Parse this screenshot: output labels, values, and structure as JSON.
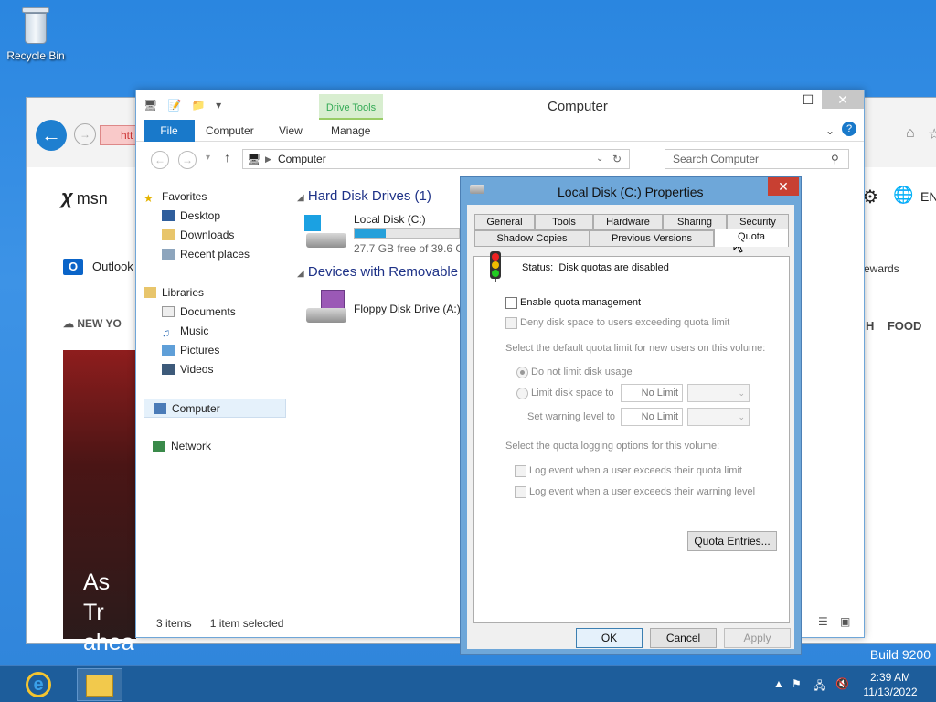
{
  "desktop": {
    "recycle_bin": "Recycle Bin",
    "build": "Build 9200"
  },
  "ie": {
    "address_fragment": "htt",
    "msn": "msn",
    "outlook": "Outlook",
    "news_fragment": "NEW YO",
    "hero_line1": "As Tr",
    "hero_line2": "ahea",
    "lang": "EN",
    "rewards": "ewards",
    "h_fragment": "H",
    "food": "FOOD"
  },
  "explorer": {
    "title": "Computer",
    "drive_tools": "Drive Tools",
    "ribbon": {
      "file": "File",
      "computer": "Computer",
      "view": "View",
      "manage": "Manage"
    },
    "address": "Computer",
    "search_placeholder": "Search Computer",
    "tree": {
      "favorites": "Favorites",
      "desktop": "Desktop",
      "downloads": "Downloads",
      "recent": "Recent places",
      "libraries": "Libraries",
      "documents": "Documents",
      "music": "Music",
      "pictures": "Pictures",
      "videos": "Videos",
      "computer": "Computer",
      "network": "Network"
    },
    "hdd_group": "Hard Disk Drives (1)",
    "local_disk": "Local Disk (C:)",
    "local_disk_free": "27.7 GB free of 39.6 GB",
    "local_disk_used_fraction": 0.3,
    "removable_group": "Devices with Removable",
    "floppy": "Floppy Disk Drive (A:)",
    "status_items": "3 items",
    "status_selected": "1 item selected"
  },
  "dialog": {
    "title": "Local Disk (C:) Properties",
    "tabs_row1": [
      "General",
      "Tools",
      "Hardware",
      "Sharing",
      "Security"
    ],
    "tabs_row2": [
      "Shadow Copies",
      "Previous Versions",
      "Quota"
    ],
    "status_label": "Status:",
    "status_value": "Disk quotas are disabled",
    "enable_quota": "Enable quota management",
    "deny_space": "Deny disk space to users exceeding quota limit",
    "default_limit_heading": "Select the default quota limit for new users on this volume:",
    "no_limit_radio": "Do not limit disk usage",
    "limit_radio": "Limit disk space to",
    "warning_label": "Set warning level to",
    "limit_value": "No Limit",
    "warning_value": "No Limit",
    "logging_heading": "Select the quota logging options for this volume:",
    "log_quota": "Log event when a user exceeds their quota limit",
    "log_warning": "Log event when a user exceeds their warning level",
    "quota_entries": "Quota Entries...",
    "ok": "OK",
    "cancel": "Cancel",
    "apply": "Apply"
  },
  "taskbar": {
    "time": "2:39 AM",
    "date": "11/13/2022"
  }
}
